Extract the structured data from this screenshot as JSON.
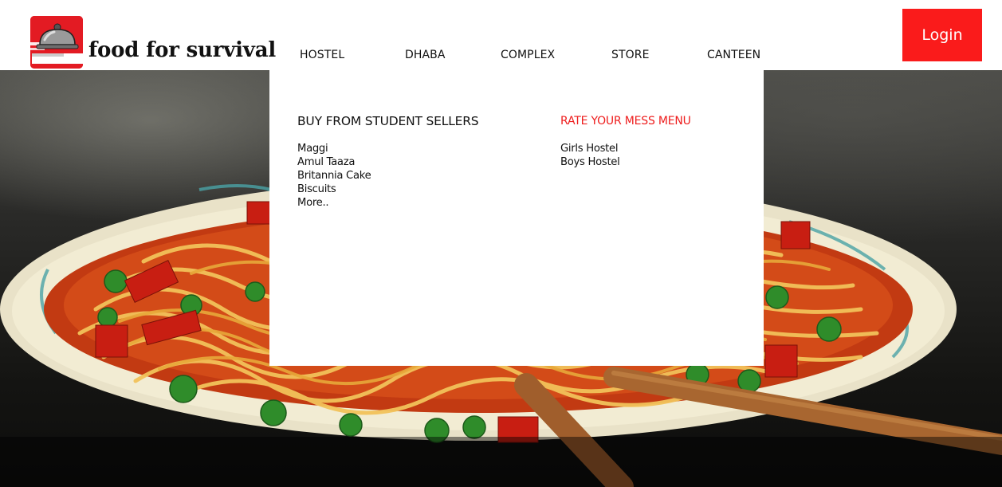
{
  "brand": {
    "name": "food for survival",
    "logo_icon": "cloche-icon",
    "accent": "#e31b23"
  },
  "nav": [
    {
      "label": "HOSTEL"
    },
    {
      "label": "DHABA"
    },
    {
      "label": "COMPLEX"
    },
    {
      "label": "STORE"
    },
    {
      "label": "CANTEEN"
    }
  ],
  "login": {
    "label": "Login",
    "color": "#fa1b1b"
  },
  "dropdown": {
    "left_column": {
      "heading": "BUY FROM STUDENT SELLERS",
      "items": [
        "Maggi",
        "Amul Taaza",
        "Britannia Cake",
        "Biscuits",
        "More.."
      ]
    },
    "right_column": {
      "heading": "RATE YOUR MESS MENU",
      "heading_color": "#ee1c1c",
      "items": [
        "Girls Hostel",
        "Boys Hostel"
      ]
    }
  }
}
